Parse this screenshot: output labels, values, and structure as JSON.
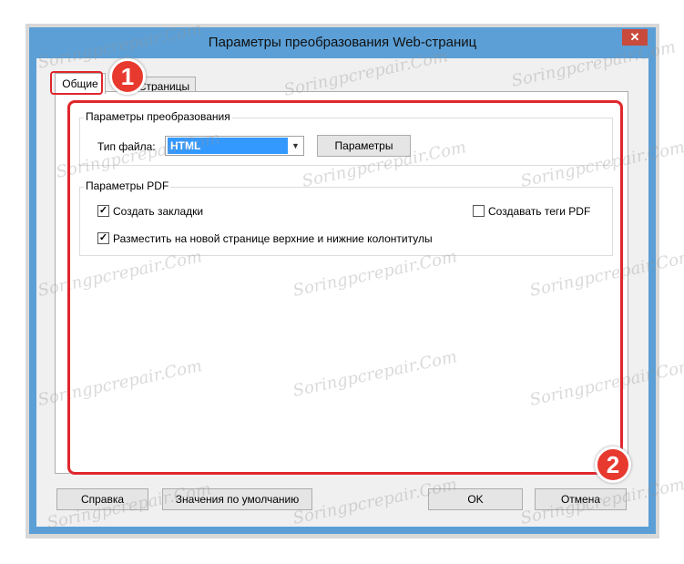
{
  "window": {
    "title": "Параметры преобразования Web-страниц",
    "close_glyph": "✕"
  },
  "tabs": [
    {
      "label": "Общие",
      "active": true
    },
    {
      "label": "Страницы",
      "active": false
    }
  ],
  "conversion_group": {
    "title": "Параметры преобразования",
    "file_type_label": "Тип файла:",
    "file_type_value": "HTML",
    "settings_button": "Параметры"
  },
  "pdf_group": {
    "title": "Параметры PDF",
    "create_bookmarks": {
      "label": "Создать закладки",
      "checked": true
    },
    "create_pdf_tags": {
      "label": "Создавать теги PDF",
      "checked": false
    },
    "place_headers": {
      "label": "Разместить на новой странице верхние и нижние колонтитулы",
      "checked": true
    }
  },
  "footer": {
    "help_button": "Справка",
    "defaults_button": "Значения по умолчанию",
    "ok_button": "OK",
    "cancel_button": "Отмена"
  },
  "annotations": {
    "badge_1": "1",
    "badge_2": "2",
    "accent_color": "#e0262d"
  },
  "watermark": "Soringpcrepair.Com"
}
